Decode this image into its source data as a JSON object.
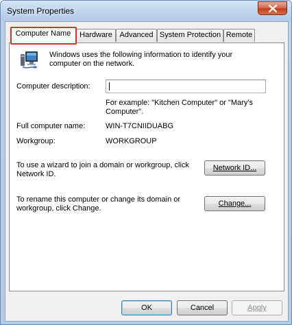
{
  "window": {
    "title": "System Properties",
    "close_glyph": "✕"
  },
  "tabs": [
    {
      "label": "Computer Name",
      "active": true
    },
    {
      "label": "Hardware",
      "active": false
    },
    {
      "label": "Advanced",
      "active": false
    },
    {
      "label": "System Protection",
      "active": false
    },
    {
      "label": "Remote",
      "active": false
    }
  ],
  "panel": {
    "icon": "computer-network-icon",
    "intro": "Windows uses the following information to identify your computer on the network.",
    "description_label": "Computer description:",
    "description_value": "",
    "example_text": "For example: \"Kitchen Computer\" or \"Mary's Computer\".",
    "full_name_label": "Full computer name:",
    "full_name_value": "WIN-T7CNIIDUABG",
    "workgroup_label": "Workgroup:",
    "workgroup_value": "WORKGROUP",
    "wizard_text": "To use a wizard to join a domain or workgroup, click Network ID.",
    "network_id_button": "Network ID...",
    "rename_text": "To rename this computer or change its domain or workgroup, click Change.",
    "change_button": "Change..."
  },
  "footer": {
    "ok": "OK",
    "cancel": "Cancel",
    "apply": "Apply"
  },
  "colors": {
    "highlight": "#d2342a",
    "frame": "#b4cbe6",
    "close_button": "#c3401f"
  }
}
